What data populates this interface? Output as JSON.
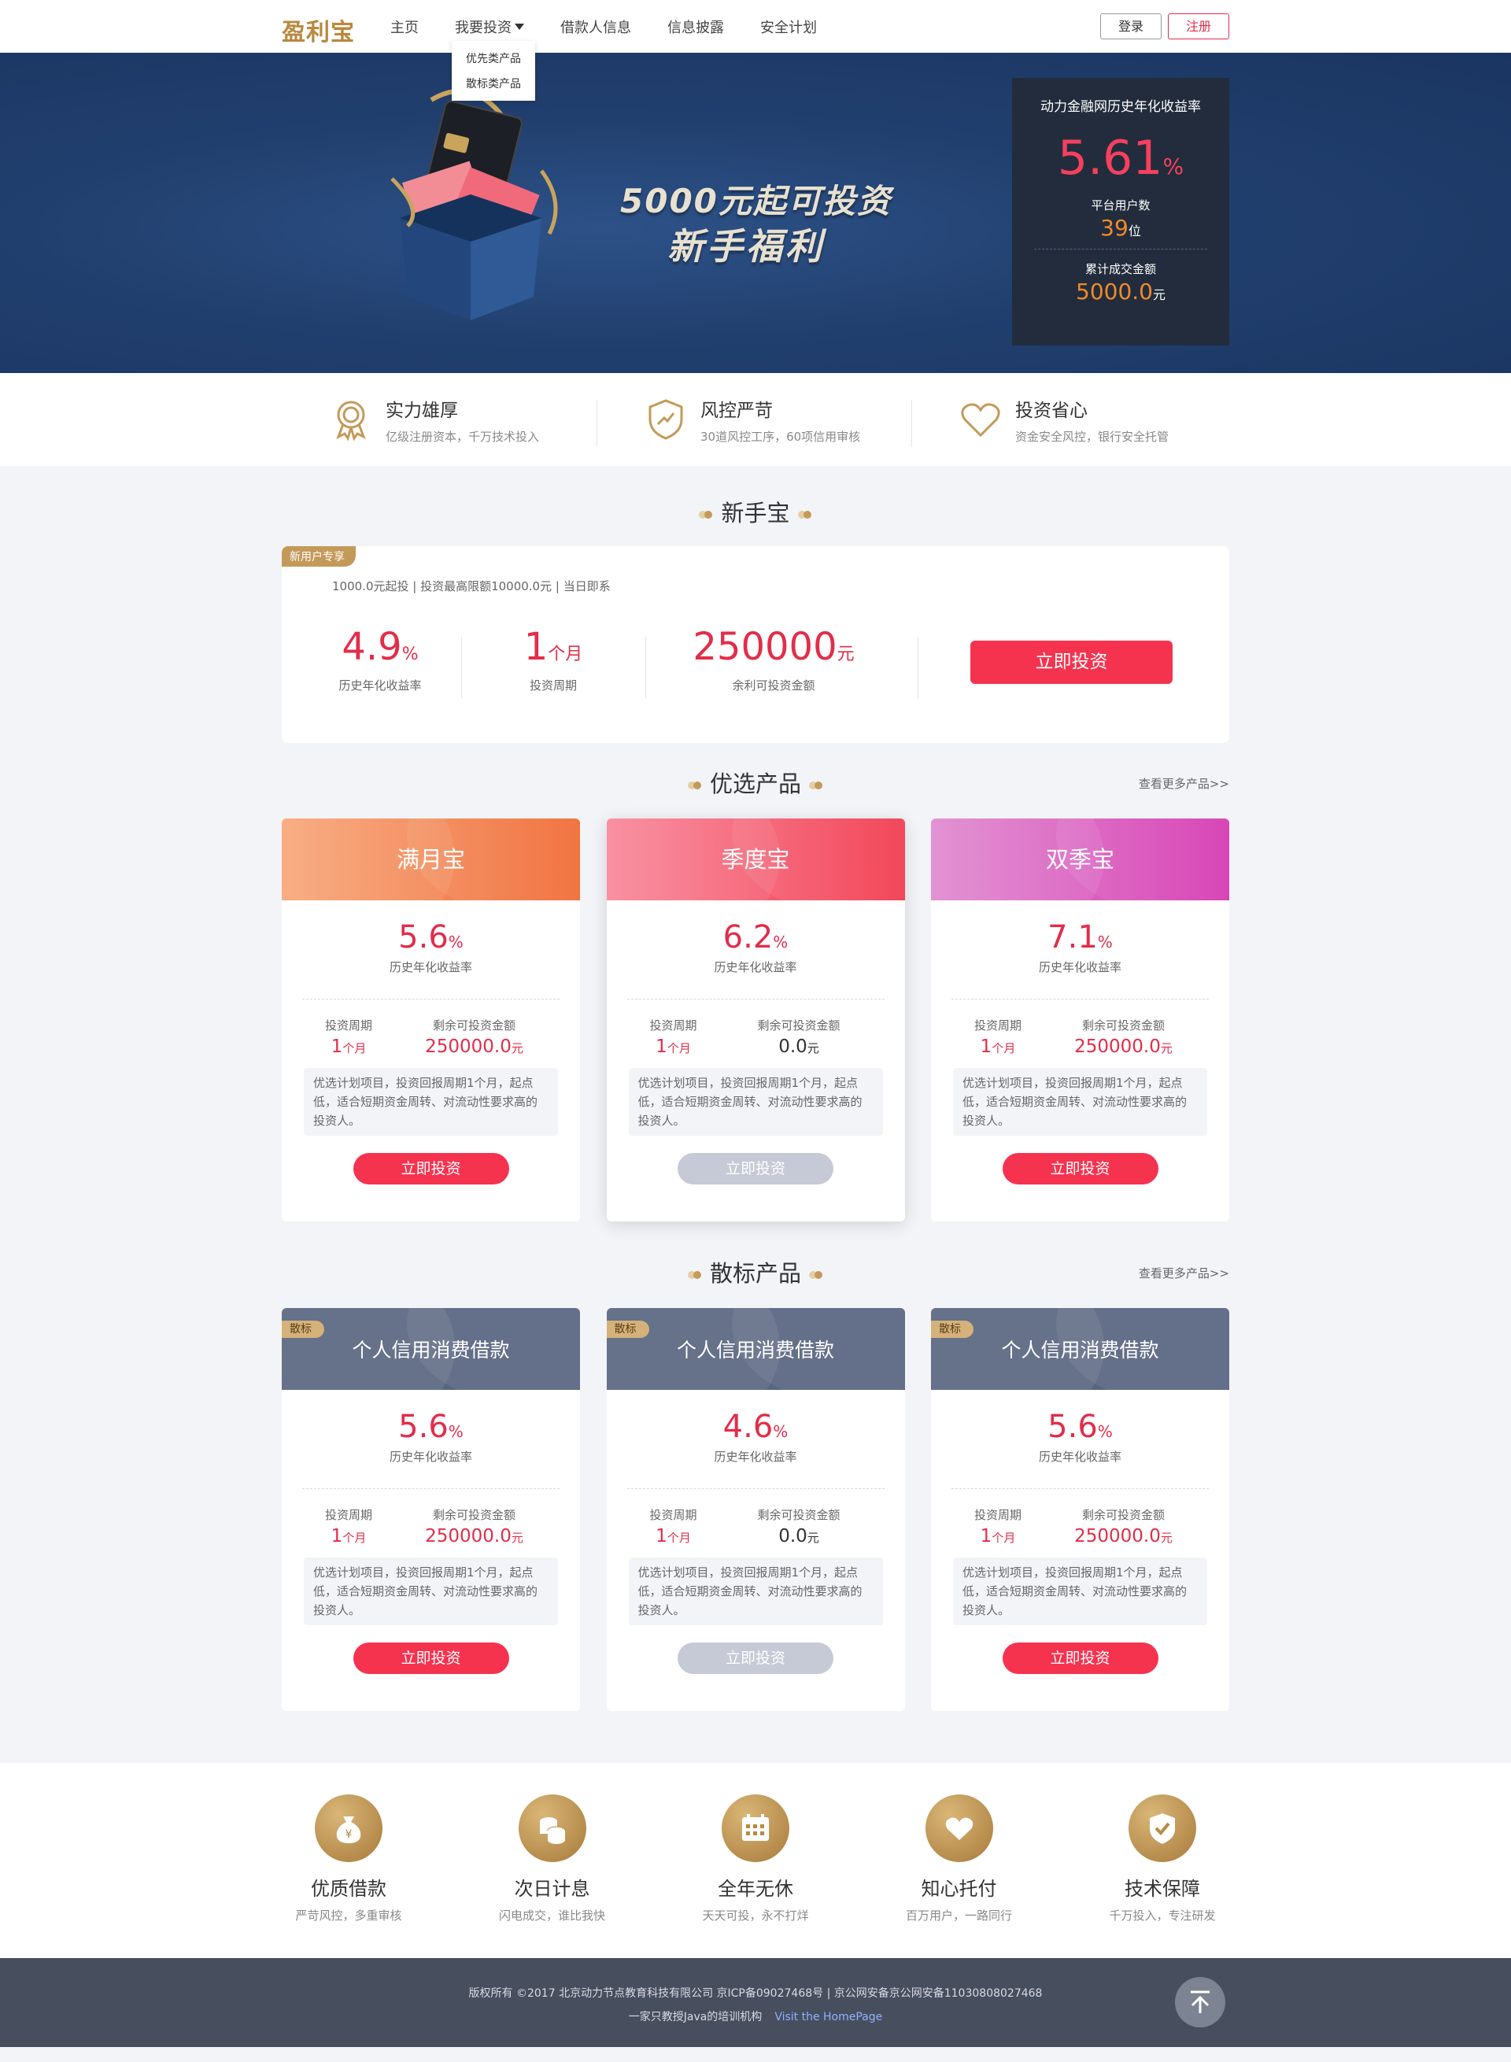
{
  "header": {
    "logo": "盈利宝",
    "nav": [
      "主页",
      "我要投资",
      "借款人信息",
      "信息披露",
      "安全计划"
    ],
    "dropdown": [
      "优先类产品",
      "散标类产品"
    ],
    "login": "登录",
    "register": "注册"
  },
  "banner": {
    "slogan_line1": "5000元起可投资",
    "slogan_line2": "新手福利",
    "stats_title": "动力金融网历史年化收益率",
    "rate_value": "5.61",
    "rate_unit": "%",
    "users_label": "平台用户数",
    "users_value": "39",
    "users_unit": "位",
    "amount_label": "累计成交金额",
    "amount_value": "5000.0",
    "amount_unit": "元"
  },
  "features": [
    {
      "icon": "medal-icon",
      "title": "实力雄厚",
      "desc": "亿级注册资本，千万技术投入"
    },
    {
      "icon": "shield-icon",
      "title": "风控严苛",
      "desc": "30道风控工序，60项信用审核"
    },
    {
      "icon": "heart-icon",
      "title": "投资省心",
      "desc": "资金安全风控，银行安全托管"
    }
  ],
  "newbie": {
    "section_title": "新手宝",
    "tag": "新用户专享",
    "info": "1000.0元起投  |  投资最高限额10000.0元  |  当日即系",
    "rate": "4.9",
    "rate_unit": "%",
    "rate_label": "历史年化收益率",
    "period": "1",
    "period_unit": "个月",
    "period_label": "投资周期",
    "remain": "250000",
    "remain_unit": "元",
    "remain_label": "余利可投资金额",
    "button": "立即投资"
  },
  "preferred": {
    "section_title": "优选产品",
    "more": "查看更多产品>>",
    "cards": [
      {
        "name": "满月宝",
        "rate": "5.6",
        "unit": "%",
        "rate_label": "历史年化收益率",
        "period_label": "投资周期",
        "period": "1",
        "period_unit": "个月",
        "remain_label": "剩余可投资金额",
        "remain": "250000.0",
        "remain_unit": "元",
        "desc": "优选计划项目，投资回报周期1个月，起点低，适合短期资金周转、对流动性要求高的投资人。",
        "button": "立即投资"
      },
      {
        "name": "季度宝",
        "rate": "6.2",
        "unit": "%",
        "rate_label": "历史年化收益率",
        "period_label": "投资周期",
        "period": "1",
        "period_unit": "个月",
        "remain_label": "剩余可投资金额",
        "remain": "0.0",
        "remain_unit": "元",
        "desc": "优选计划项目，投资回报周期1个月，起点低，适合短期资金周转、对流动性要求高的投资人。",
        "button": "立即投资"
      },
      {
        "name": "双季宝",
        "rate": "7.1",
        "unit": "%",
        "rate_label": "历史年化收益率",
        "period_label": "投资周期",
        "period": "1",
        "period_unit": "个月",
        "remain_label": "剩余可投资金额",
        "remain": "250000.0",
        "remain_unit": "元",
        "desc": "优选计划项目，投资回报周期1个月，起点低，适合短期资金周转、对流动性要求高的投资人。",
        "button": "立即投资"
      }
    ]
  },
  "loans": {
    "section_title": "散标产品",
    "more": "查看更多产品>>",
    "cards": [
      {
        "tag": "散标",
        "name": "个人信用消费借款",
        "rate": "5.6",
        "unit": "%",
        "rate_label": "历史年化收益率",
        "period_label": "投资周期",
        "period": "1",
        "period_unit": "个月",
        "remain_label": "剩余可投资金额",
        "remain": "250000.0",
        "remain_unit": "元",
        "desc": "优选计划项目，投资回报周期1个月，起点低，适合短期资金周转、对流动性要求高的投资人。",
        "button": "立即投资"
      },
      {
        "tag": "散标",
        "name": "个人信用消费借款",
        "rate": "4.6",
        "unit": "%",
        "rate_label": "历史年化收益率",
        "period_label": "投资周期",
        "period": "1",
        "period_unit": "个月",
        "remain_label": "剩余可投资金额",
        "remain": "0.0",
        "remain_unit": "元",
        "desc": "优选计划项目，投资回报周期1个月，起点低，适合短期资金周转、对流动性要求高的投资人。",
        "button": "立即投资"
      },
      {
        "tag": "散标",
        "name": "个人信用消费借款",
        "rate": "5.6",
        "unit": "%",
        "rate_label": "历史年化收益率",
        "period_label": "投资周期",
        "period": "1",
        "period_unit": "个月",
        "remain_label": "剩余可投资金额",
        "remain": "250000.0",
        "remain_unit": "元",
        "desc": "优选计划项目，投资回报周期1个月，起点低，适合短期资金周转、对流动性要求高的投资人。",
        "button": "立即投资"
      }
    ]
  },
  "bottom_features": [
    {
      "icon": "money-bag-icon",
      "title": "优质借款",
      "desc": "严苛风控，多重审核"
    },
    {
      "icon": "coins-icon",
      "title": "次日计息",
      "desc": "闪电成交，谁比我快"
    },
    {
      "icon": "calendar-icon",
      "title": "全年无休",
      "desc": "天天可投，永不打烊"
    },
    {
      "icon": "heart-hand-icon",
      "title": "知心托付",
      "desc": "百万用户，一路同行"
    },
    {
      "icon": "shield-check-icon",
      "title": "技术保障",
      "desc": "千万投入，专注研发"
    }
  ],
  "footer": {
    "copyright": "版权所有 ©2017 北京动力节点教育科技有限公司 京ICP备09027468号 | 京公网安备京公网安备11030808027468",
    "tagline": "一家只教授Java的培训机构",
    "link": "Visit the HomePage"
  },
  "colors": {
    "accent": "#f5334f",
    "gold": "#c49a5a",
    "navy": "#213f6e",
    "disabled": "#c6cad6"
  }
}
